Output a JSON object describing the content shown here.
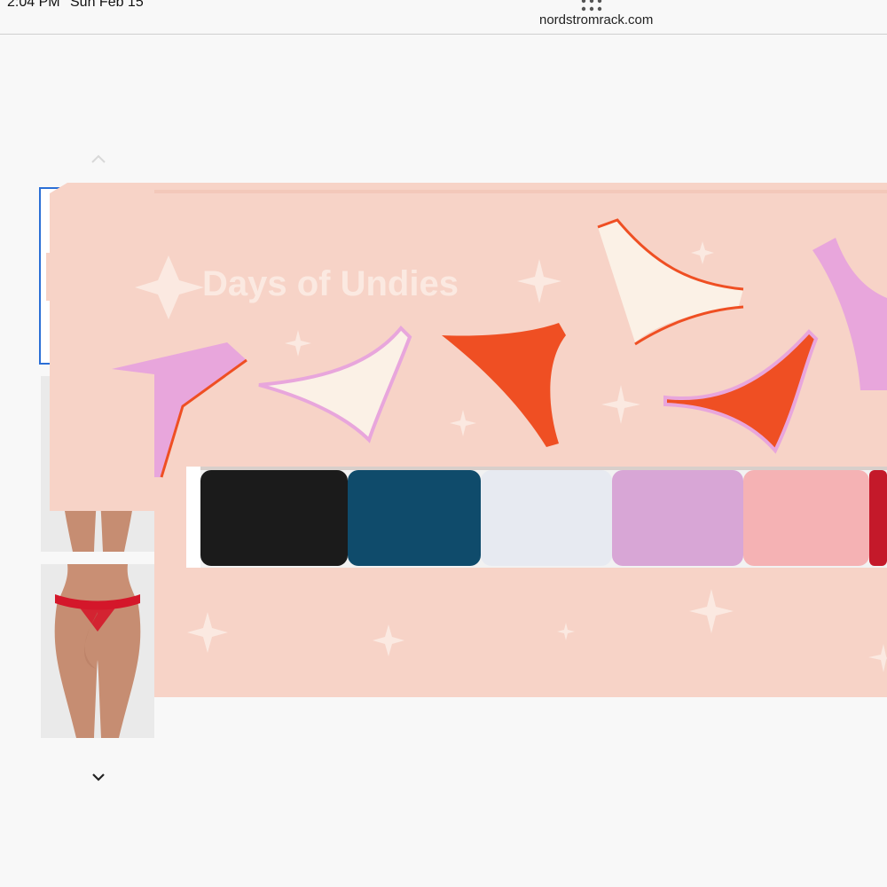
{
  "status": {
    "time": "2:04 PM",
    "date": "Sun Feb 15"
  },
  "browser": {
    "url": "nordstromrack.com"
  },
  "product": {
    "box_title": "Days of Undies",
    "thumbnails": [
      "box-front",
      "model-front-red",
      "model-back-red"
    ],
    "selected_thumbnail": 0,
    "swatch_colors": [
      "#1b1b1b",
      "#0f4b6b",
      "#e7eaf1",
      "#d8a6d6",
      "#f5b2b4",
      "#c4192a"
    ]
  },
  "colors": {
    "box": "#f7d3c7",
    "accent_orange": "#ef4f23",
    "accent_pink": "#e8a6dc",
    "cream": "#fbf1e6",
    "selection": "#2b6fd6"
  }
}
